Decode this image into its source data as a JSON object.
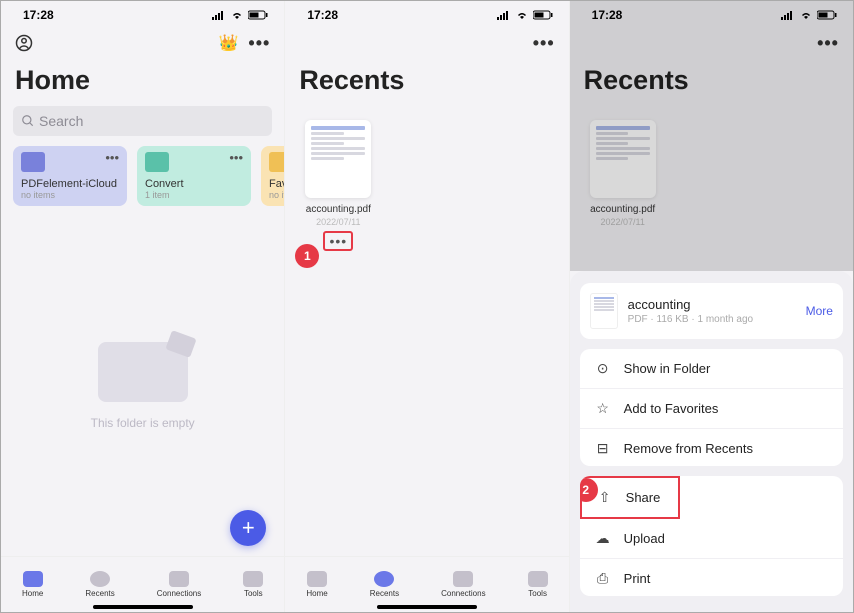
{
  "status": {
    "time": "17:28"
  },
  "home": {
    "title": "Home",
    "search_placeholder": "Search",
    "folders": [
      {
        "name": "PDFelement-iCloud",
        "sub": "no items"
      },
      {
        "name": "Convert",
        "sub": "1 item"
      },
      {
        "name": "Favori",
        "sub": "no item"
      }
    ],
    "empty": "This folder is empty",
    "tabs": [
      "Home",
      "Recents",
      "Connections",
      "Tools"
    ]
  },
  "recents": {
    "title": "Recents",
    "file": {
      "name": "accounting.pdf",
      "date": "2022/07/11"
    }
  },
  "sheet": {
    "file_name": "accounting",
    "file_meta": "PDF · 116 KB · 1 month ago",
    "more": "More",
    "actions": {
      "show": "Show in Folder",
      "fav": "Add to Favorites",
      "remove": "Remove from Recents",
      "share": "Share",
      "upload": "Upload",
      "print": "Print"
    }
  },
  "callouts": {
    "one": "1",
    "two": "2"
  }
}
